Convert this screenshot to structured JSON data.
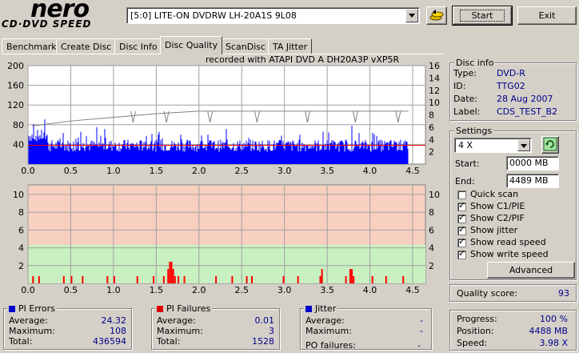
{
  "logo": {
    "brand": "nero",
    "product": "CD·DVD SPEED"
  },
  "drive": {
    "selected": "[5:0]  LITE-ON DVDRW LH-20A1S 9L08"
  },
  "buttons": {
    "start": "Start",
    "exit": "Exit",
    "advanced": "Advanced"
  },
  "tabs": [
    "Benchmark",
    "Create Disc",
    "Disc Info",
    "Disc Quality",
    "ScanDisc",
    "TA Jitter"
  ],
  "active_tab": "Disc Quality",
  "recorded_with": "recorded with ATAPI    DVD  A   DH20A3P    vXP5R",
  "disc_info": {
    "title": "Disc info",
    "type_label": "Type:",
    "type_value": "DVD-R",
    "id_label": "ID:",
    "id_value": "TTG02",
    "date_label": "Date:",
    "date_value": "28 Aug 2007",
    "label_label": "Label:",
    "label_value": "CDS_TEST_B2"
  },
  "settings": {
    "title": "Settings",
    "speed": "4 X",
    "start_label": "Start:",
    "start_value": "0000 MB",
    "end_label": "End:",
    "end_value": "4489 MB",
    "checks": [
      {
        "label": "Quick scan",
        "checked": false
      },
      {
        "label": "Show C1/PIE",
        "checked": true
      },
      {
        "label": "Show C2/PIF",
        "checked": true
      },
      {
        "label": "Show jitter",
        "checked": true
      },
      {
        "label": "Show read speed",
        "checked": true
      },
      {
        "label": "Show write speed",
        "checked": true
      }
    ]
  },
  "quality": {
    "label": "Quality score:",
    "value": "93"
  },
  "progress": {
    "progress_label": "Progress:",
    "progress_value": "100 %",
    "position_label": "Position:",
    "position_value": "4488 MB",
    "speed_label": "Speed:",
    "speed_value": "3.98 X"
  },
  "pi_errors": {
    "title": "PI Errors",
    "color": "#0000cc",
    "average_label": "Average:",
    "average": "24.32",
    "maximum_label": "Maximum:",
    "maximum": "108",
    "total_label": "Total:",
    "total": "436594"
  },
  "pi_failures": {
    "title": "PI Failures",
    "color": "#dd0000",
    "average_label": "Average:",
    "average": "0.01",
    "maximum_label": "Maximum:",
    "maximum": "3",
    "total_label": "Total:",
    "total": "1528"
  },
  "jitter": {
    "title": "Jitter",
    "color": "#0000cc",
    "average_label": "Average:",
    "average": "-",
    "maximum_label": "Maximum:",
    "maximum": "-",
    "po_label": "PO failures:",
    "po_value": "-"
  },
  "chart_data": [
    {
      "type": "bar",
      "x_ticks": [
        "0.0",
        "0.5",
        "1.0",
        "1.5",
        "2.0",
        "2.5",
        "3.0",
        "3.5",
        "4.0",
        "4.5"
      ],
      "y_left_ticks": [
        "200",
        "160",
        "120",
        "80",
        "40"
      ],
      "y_right_ticks": [
        "16",
        "14",
        "12",
        "10",
        "8",
        "6",
        "4",
        "2"
      ],
      "xlim": [
        0,
        4.5
      ],
      "ylim_left": [
        0,
        200
      ],
      "ylim_right": [
        0,
        16
      ],
      "series": [
        {
          "values_profile": "PI errors per block, typically 30-60, peaks near 108",
          "color": "#0000ff"
        },
        {
          "color": "#ff0000",
          "constant": 4
        },
        {
          "color": "#808080",
          "points": [
            [
              0.05,
              6.2
            ],
            [
              0.5,
              7.0
            ],
            [
              1.0,
              7.6
            ],
            [
              1.5,
              8.2
            ],
            [
              2.0,
              8.6
            ],
            [
              2.5,
              8.6
            ],
            [
              3.0,
              8.6
            ],
            [
              3.5,
              8.6
            ],
            [
              4.0,
              8.6
            ],
            [
              4.45,
              8.6
            ]
          ]
        }
      ],
      "dips": [
        1.23,
        1.62,
        2.13,
        2.68,
        3.27,
        3.83,
        4.33
      ]
    },
    {
      "type": "bar",
      "x_ticks": [
        "0.0",
        "0.5",
        "1.0",
        "1.5",
        "2.0",
        "2.5",
        "3.0",
        "3.5",
        "4.0",
        "4.5"
      ],
      "y_left_ticks": [
        "10",
        "8",
        "6",
        "4",
        "2"
      ],
      "y_right_ticks": [
        "10",
        "8",
        "6",
        "4",
        "2"
      ],
      "xlim": [
        0,
        4.5
      ],
      "ylim": [
        0,
        10
      ],
      "pif_bars": [
        [
          0.05,
          1
        ],
        [
          0.12,
          1
        ],
        [
          0.41,
          1
        ],
        [
          0.5,
          1
        ],
        [
          0.63,
          1
        ],
        [
          0.92,
          1
        ],
        [
          1.0,
          1
        ],
        [
          1.27,
          1
        ],
        [
          1.46,
          1
        ],
        [
          1.58,
          1
        ],
        [
          1.63,
          2
        ],
        [
          1.65,
          3
        ],
        [
          1.67,
          3
        ],
        [
          1.69,
          2
        ],
        [
          1.71,
          1
        ],
        [
          1.75,
          1
        ],
        [
          1.82,
          1
        ],
        [
          2.19,
          1
        ],
        [
          2.38,
          1
        ],
        [
          2.55,
          1
        ],
        [
          2.61,
          1
        ],
        [
          2.98,
          1
        ],
        [
          3.15,
          1
        ],
        [
          3.41,
          1
        ],
        [
          3.43,
          2
        ],
        [
          3.71,
          1
        ],
        [
          3.76,
          2
        ],
        [
          3.78,
          2
        ],
        [
          3.8,
          1
        ],
        [
          4.02,
          1
        ],
        [
          4.18,
          1
        ],
        [
          4.38,
          1
        ]
      ]
    }
  ]
}
